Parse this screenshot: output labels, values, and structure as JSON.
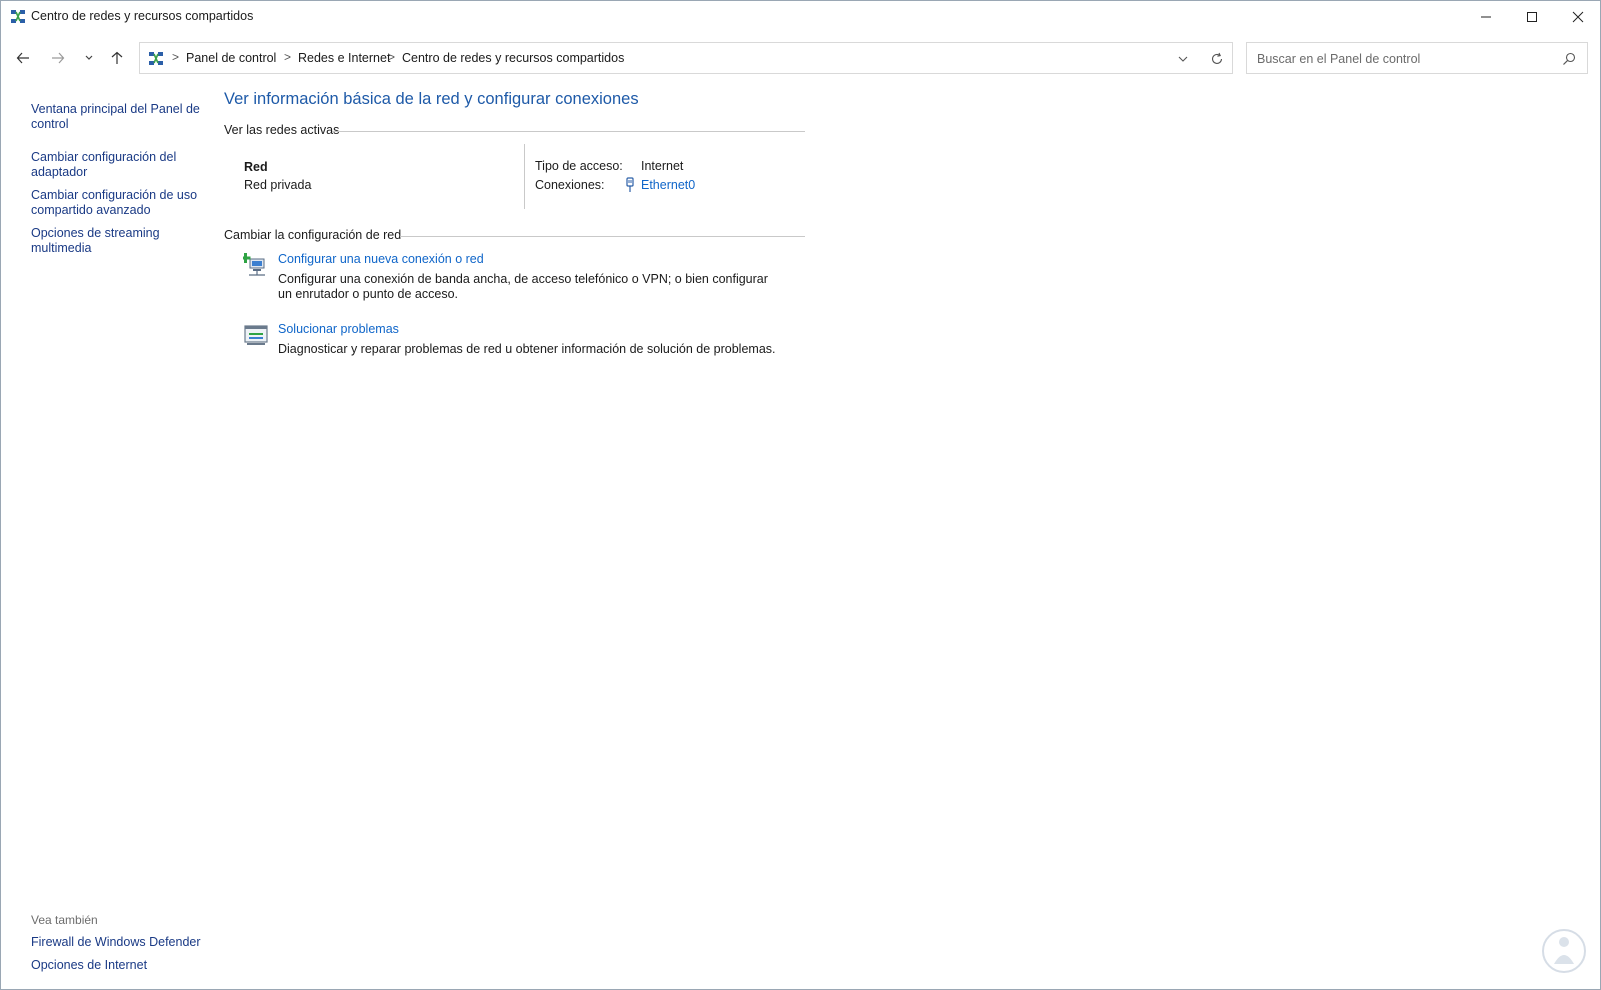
{
  "window": {
    "title": "Centro de redes y recursos compartidos",
    "controls": [
      "minimize",
      "maximize",
      "close"
    ]
  },
  "nav": {
    "breadcrumbs": [
      "Panel de control",
      "Redes e Internet",
      "Centro de redes y recursos compartidos"
    ],
    "separator": ">",
    "search_placeholder": "Buscar en el Panel de control"
  },
  "sidebar": {
    "links": [
      "Ventana principal del Panel de control",
      "Cambiar configuración del adaptador",
      "Cambiar configuración de uso compartido avanzado",
      "Opciones de streaming multimedia"
    ],
    "see_also_title": "Vea también",
    "see_also": [
      "Firewall de Windows Defender",
      "Opciones de Internet"
    ]
  },
  "main": {
    "title": "Ver información básica de la red y configurar conexiones",
    "active_networks_header": "Ver las redes activas",
    "network": {
      "name": "Red",
      "profile": "Red privada",
      "access_type_label": "Tipo de acceso:",
      "access_type_value": "Internet",
      "connections_label": "Conexiones:",
      "connection_name": "Ethernet0"
    },
    "change_settings_header": "Cambiar la configuración de red",
    "tasks": [
      {
        "title": "Configurar una nueva conexión o red",
        "description": "Configurar una conexión de banda ancha, de acceso telefónico o VPN; o bien configurar un enrutador o punto de acceso.",
        "icon": "new-connection-icon"
      },
      {
        "title": "Solucionar problemas",
        "description": "Diagnosticar y reparar problemas de red u obtener información de solución de problemas.",
        "icon": "troubleshoot-icon"
      }
    ]
  },
  "colors": {
    "title_blue": "#1e5aa8",
    "link_blue": "#1066c9",
    "sidebar_link": "#1a3a85"
  }
}
